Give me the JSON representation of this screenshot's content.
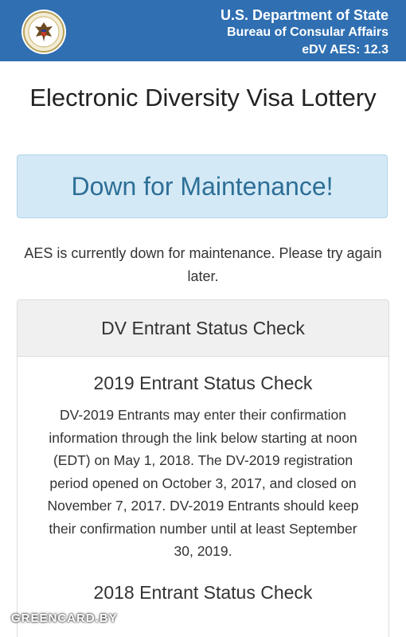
{
  "header": {
    "department": "U.S. Department of State",
    "bureau": "Bureau of Consular Affairs",
    "version": "eDV AES: 12.3"
  },
  "title": "Electronic Diversity Visa Lottery",
  "banner": {
    "text": "Down for Maintenance!"
  },
  "notice": "AES is currently down for maintenance. Please try again later.",
  "panel": {
    "heading": "DV Entrant Status Check",
    "section1": {
      "title": "2019 Entrant Status Check",
      "body": "DV-2019 Entrants may enter their confirmation information through the link below starting at noon (EDT) on May 1, 2018. The DV-2019 registration period opened on October 3, 2017, and closed on November 7, 2017. DV-2019 Entrants should keep their confirmation number until at least September 30, 2019."
    },
    "section2": {
      "title": "2018 Entrant Status Check"
    }
  },
  "watermark": "GREENCARD.BY",
  "colors": {
    "header_bg": "#2f6fb2",
    "banner_bg": "#d4e9f6",
    "banner_text": "#2d6f97"
  }
}
